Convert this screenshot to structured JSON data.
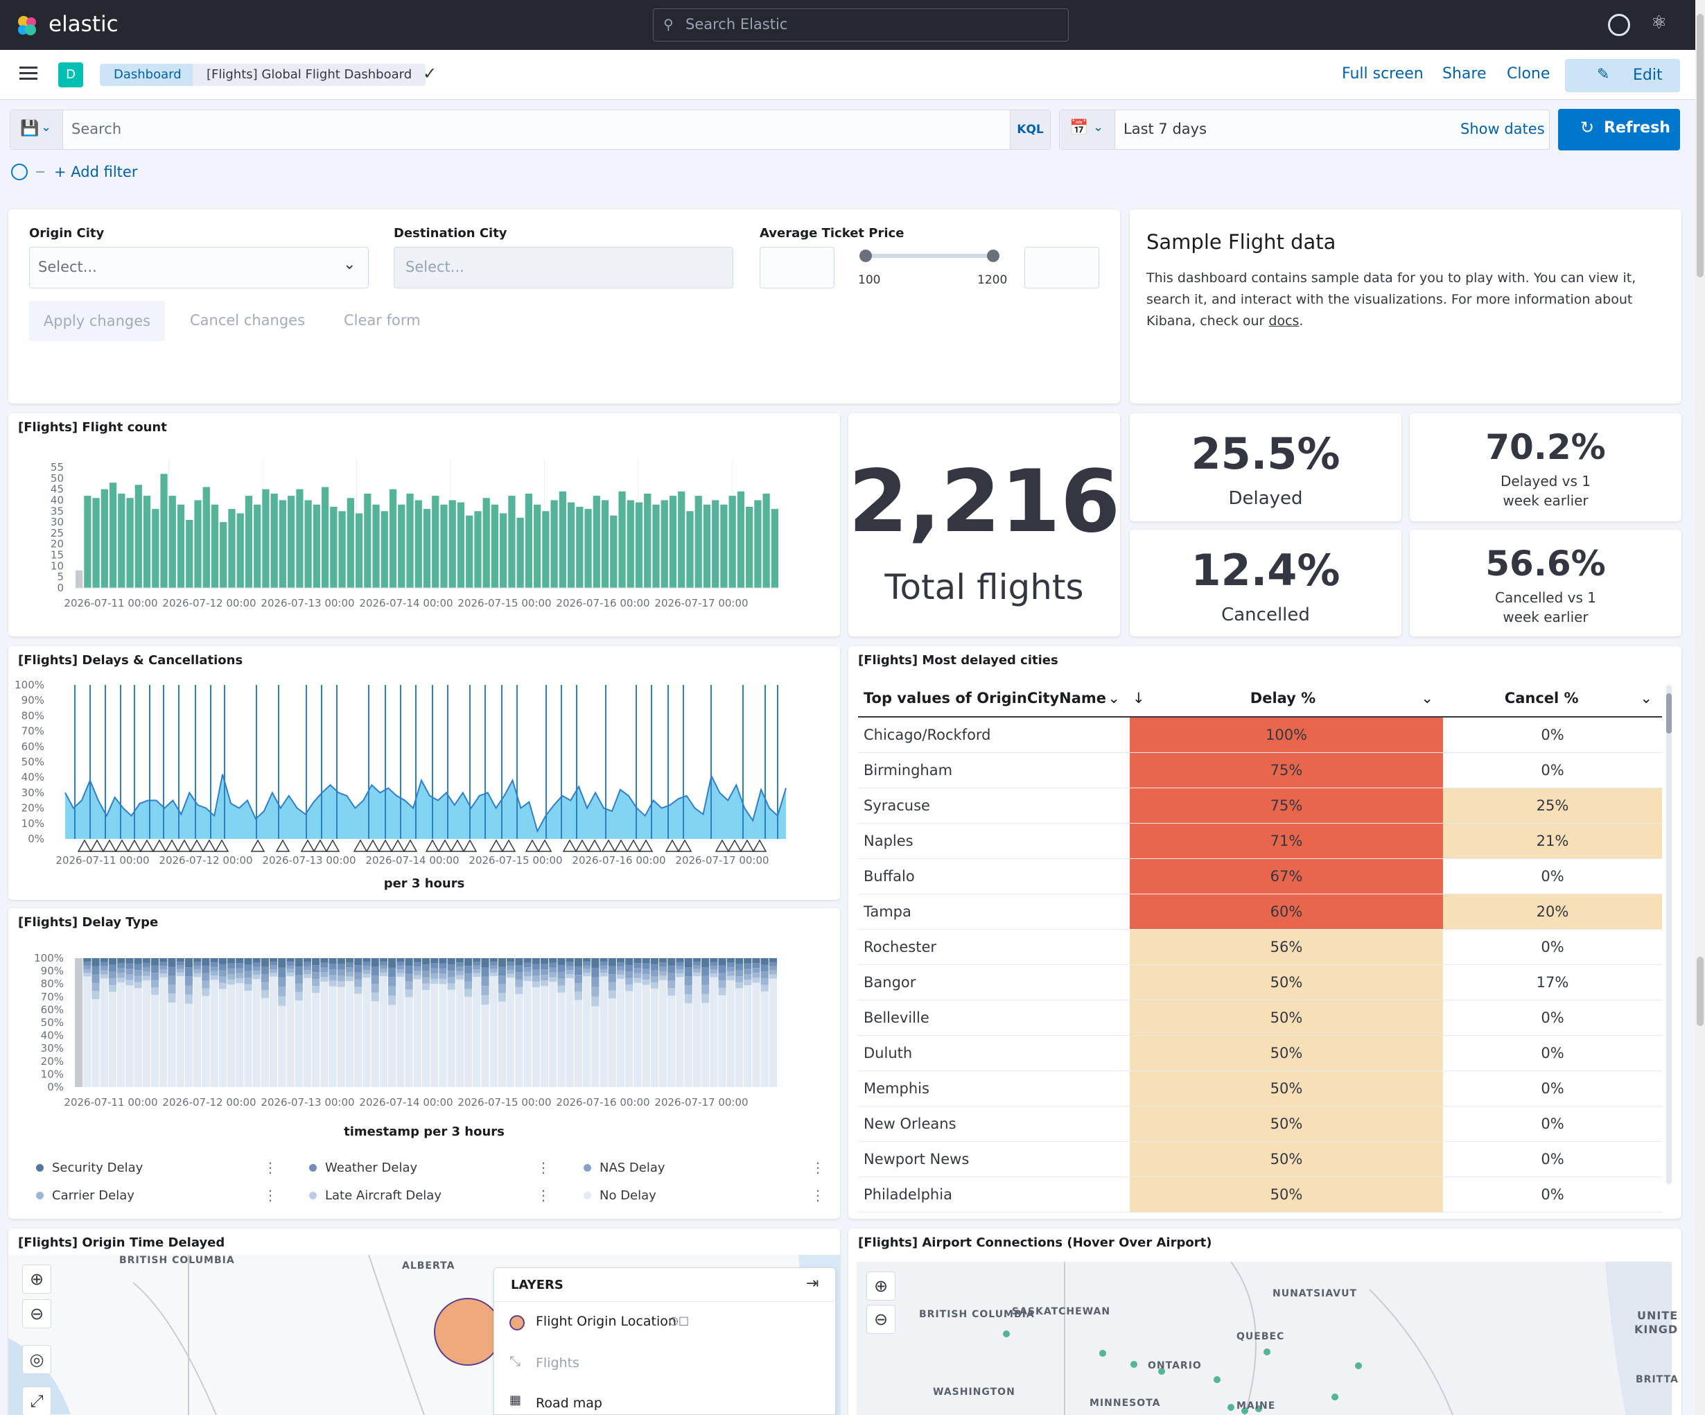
{
  "header": {
    "brand": "elastic",
    "search_placeholder": "Search Elastic"
  },
  "nav": {
    "space_initial": "D",
    "breadcrumbs": [
      "Dashboard",
      "[Flights] Global Flight Dashboard"
    ],
    "actions": {
      "full_screen": "Full screen",
      "share": "Share",
      "clone": "Clone",
      "edit": "Edit"
    }
  },
  "query_bar": {
    "search_placeholder": "Search",
    "kql": "KQL",
    "time_range": "Last 7 days",
    "show_dates": "Show dates",
    "refresh": "Refresh",
    "add_filter": "+ Add filter"
  },
  "controls": {
    "origin_label": "Origin City",
    "origin_placeholder": "Select...",
    "dest_label": "Destination City",
    "dest_placeholder": "Select...",
    "price_label": "Average Ticket Price",
    "price_min": "100",
    "price_max": "1200",
    "apply": "Apply changes",
    "cancel": "Cancel changes",
    "clear": "Clear form"
  },
  "markdown": {
    "title": "Sample Flight data",
    "body": "This dashboard contains sample data for you to play with. You can view it, search it, and interact with the visualizations. For more information about Kibana, check our ",
    "link": "docs",
    "end": "."
  },
  "metrics": {
    "total_value": "2,216",
    "total_label": "Total flights",
    "delayed_value": "25.5%",
    "delayed_label": "Delayed",
    "cancelled_value": "12.4%",
    "cancelled_label": "Cancelled",
    "delayed_vs_value": "70.2%",
    "delayed_vs_label1": "Delayed vs 1",
    "delayed_vs_label2": "week earlier",
    "cancelled_vs_value": "56.6%",
    "cancelled_vs_label1": "Cancelled vs 1",
    "cancelled_vs_label2": "week earlier"
  },
  "panels": {
    "flight_count": "[Flights] Flight count",
    "delays": "[Flights] Delays & Cancellations",
    "delays_xlabel": "per 3 hours",
    "delay_type": "[Flights] Delay Type",
    "delay_type_xlabel": "timestamp per 3 hours",
    "cities": "[Flights] Most delayed cities",
    "origin_time": "[Flights] Origin Time Delayed",
    "airport": "[Flights] Airport Connections (Hover Over Airport)"
  },
  "date_ticks": [
    "2026-07-11 00:00",
    "2026-07-12 00:00",
    "2026-07-13 00:00",
    "2026-07-14 00:00",
    "2026-07-15 00:00",
    "2026-07-16 00:00",
    "2026-07-17 00:00"
  ],
  "chart_data": [
    {
      "type": "bar",
      "title": "[Flights] Flight count",
      "ylim": [
        0,
        55
      ],
      "yticks": [
        0,
        5,
        10,
        15,
        20,
        25,
        30,
        35,
        40,
        45,
        50,
        55
      ],
      "values": [
        8,
        42,
        41,
        45,
        48,
        43,
        41,
        47,
        42,
        36,
        52,
        42,
        38,
        31,
        40,
        46,
        38,
        30,
        36,
        34,
        42,
        38,
        45,
        43,
        40,
        42,
        45,
        40,
        38,
        46,
        37,
        35,
        41,
        34,
        43,
        38,
        35,
        45,
        38,
        43,
        40,
        36,
        42,
        38,
        40,
        39,
        33,
        35,
        41,
        38,
        34,
        42,
        32,
        43,
        38,
        35,
        40,
        44,
        39,
        37,
        36,
        42,
        40,
        33,
        44,
        40,
        39,
        43,
        38,
        40,
        42,
        44,
        35,
        42,
        38,
        40,
        38,
        42,
        44,
        37,
        40,
        43,
        36
      ]
    },
    {
      "type": "area",
      "title": "[Flights] Delays & Cancellations",
      "xlabel": "per 3 hours",
      "yticks": [
        "0%",
        "10%",
        "20%",
        "30%",
        "40%",
        "50%",
        "60%",
        "70%",
        "80%",
        "90%",
        "100%"
      ],
      "values": [
        0.3,
        0.2,
        0.25,
        0.38,
        0.25,
        0.15,
        0.27,
        0.2,
        0.15,
        0.23,
        0.25,
        0.25,
        0.2,
        0.25,
        0.16,
        0.3,
        0.22,
        0.2,
        0.15,
        0.42,
        0.23,
        0.2,
        0.25,
        0.13,
        0.18,
        0.3,
        0.2,
        0.28,
        0.2,
        0.16,
        0.24,
        0.3,
        0.35,
        0.3,
        0.28,
        0.2,
        0.25,
        0.35,
        0.3,
        0.33,
        0.28,
        0.25,
        0.2,
        0.38,
        0.28,
        0.25,
        0.3,
        0.22,
        0.3,
        0.2,
        0.28,
        0.3,
        0.2,
        0.28,
        0.38,
        0.2,
        0.24,
        0.05,
        0.15,
        0.22,
        0.28,
        0.25,
        0.34,
        0.2,
        0.3,
        0.2,
        0.18,
        0.32,
        0.28,
        0.2,
        0.15,
        0.25,
        0.2,
        0.22,
        0.26,
        0.28,
        0.2,
        0.16,
        0.41,
        0.3,
        0.25,
        0.35,
        0.2,
        0.12,
        0.32,
        0.2,
        0.15,
        0.33
      ]
    },
    {
      "type": "bar",
      "title": "[Flights] Delay Type",
      "xlabel": "timestamp per 3 hours",
      "yticks": [
        "0%",
        "10%",
        "20%",
        "30%",
        "40%",
        "50%",
        "60%",
        "70%",
        "80%",
        "90%",
        "100%"
      ],
      "series": [
        {
          "name": "Security Delay",
          "color": "#54779c"
        },
        {
          "name": "Carrier Delay",
          "color": "#9db6d5"
        },
        {
          "name": "Weather Delay",
          "color": "#6e8fb7"
        },
        {
          "name": "Late Aircraft Delay",
          "color": "#b9cde3"
        },
        {
          "name": "NAS Delay",
          "color": "#86a3c7"
        },
        {
          "name": "No Delay",
          "color": "#e2eaf4"
        }
      ]
    }
  ],
  "cities_table": {
    "headers": [
      "Top values of OriginCityName",
      "Delay %",
      "Cancel %"
    ],
    "rows": [
      [
        "Chicago/Rockford",
        "100%",
        "0%"
      ],
      [
        "Birmingham",
        "75%",
        "0%"
      ],
      [
        "Syracuse",
        "75%",
        "25%"
      ],
      [
        "Naples",
        "71%",
        "21%"
      ],
      [
        "Buffalo",
        "67%",
        "0%"
      ],
      [
        "Tampa",
        "60%",
        "20%"
      ],
      [
        "Rochester",
        "56%",
        "0%"
      ],
      [
        "Bangor",
        "50%",
        "17%"
      ],
      [
        "Belleville",
        "50%",
        "0%"
      ],
      [
        "Duluth",
        "50%",
        "0%"
      ],
      [
        "Memphis",
        "50%",
        "0%"
      ],
      [
        "New Orleans",
        "50%",
        "0%"
      ],
      [
        "Newport News",
        "50%",
        "0%"
      ],
      [
        "Philadelphia",
        "50%",
        "0%"
      ]
    ],
    "colors": {
      "high": "#e7664c",
      "mid": "#f7dfb7"
    }
  },
  "map_left": {
    "labels": [
      "BRITISH COLUMBIA",
      "ALBERTA"
    ],
    "layers_title": "LAYERS",
    "layers": [
      "Flight Origin Location",
      "Flights",
      "Road map"
    ]
  },
  "map_right": {
    "labels": [
      "BRITISH COLUMBIA",
      "SASKATCHEWAN",
      "NUNATSIAVUT",
      "QUEBEC",
      "ONTARIO",
      "WASHINGTON",
      "MINNESOTA",
      "MAINE",
      "UNITE",
      "KINGD",
      "BRITTA"
    ]
  }
}
